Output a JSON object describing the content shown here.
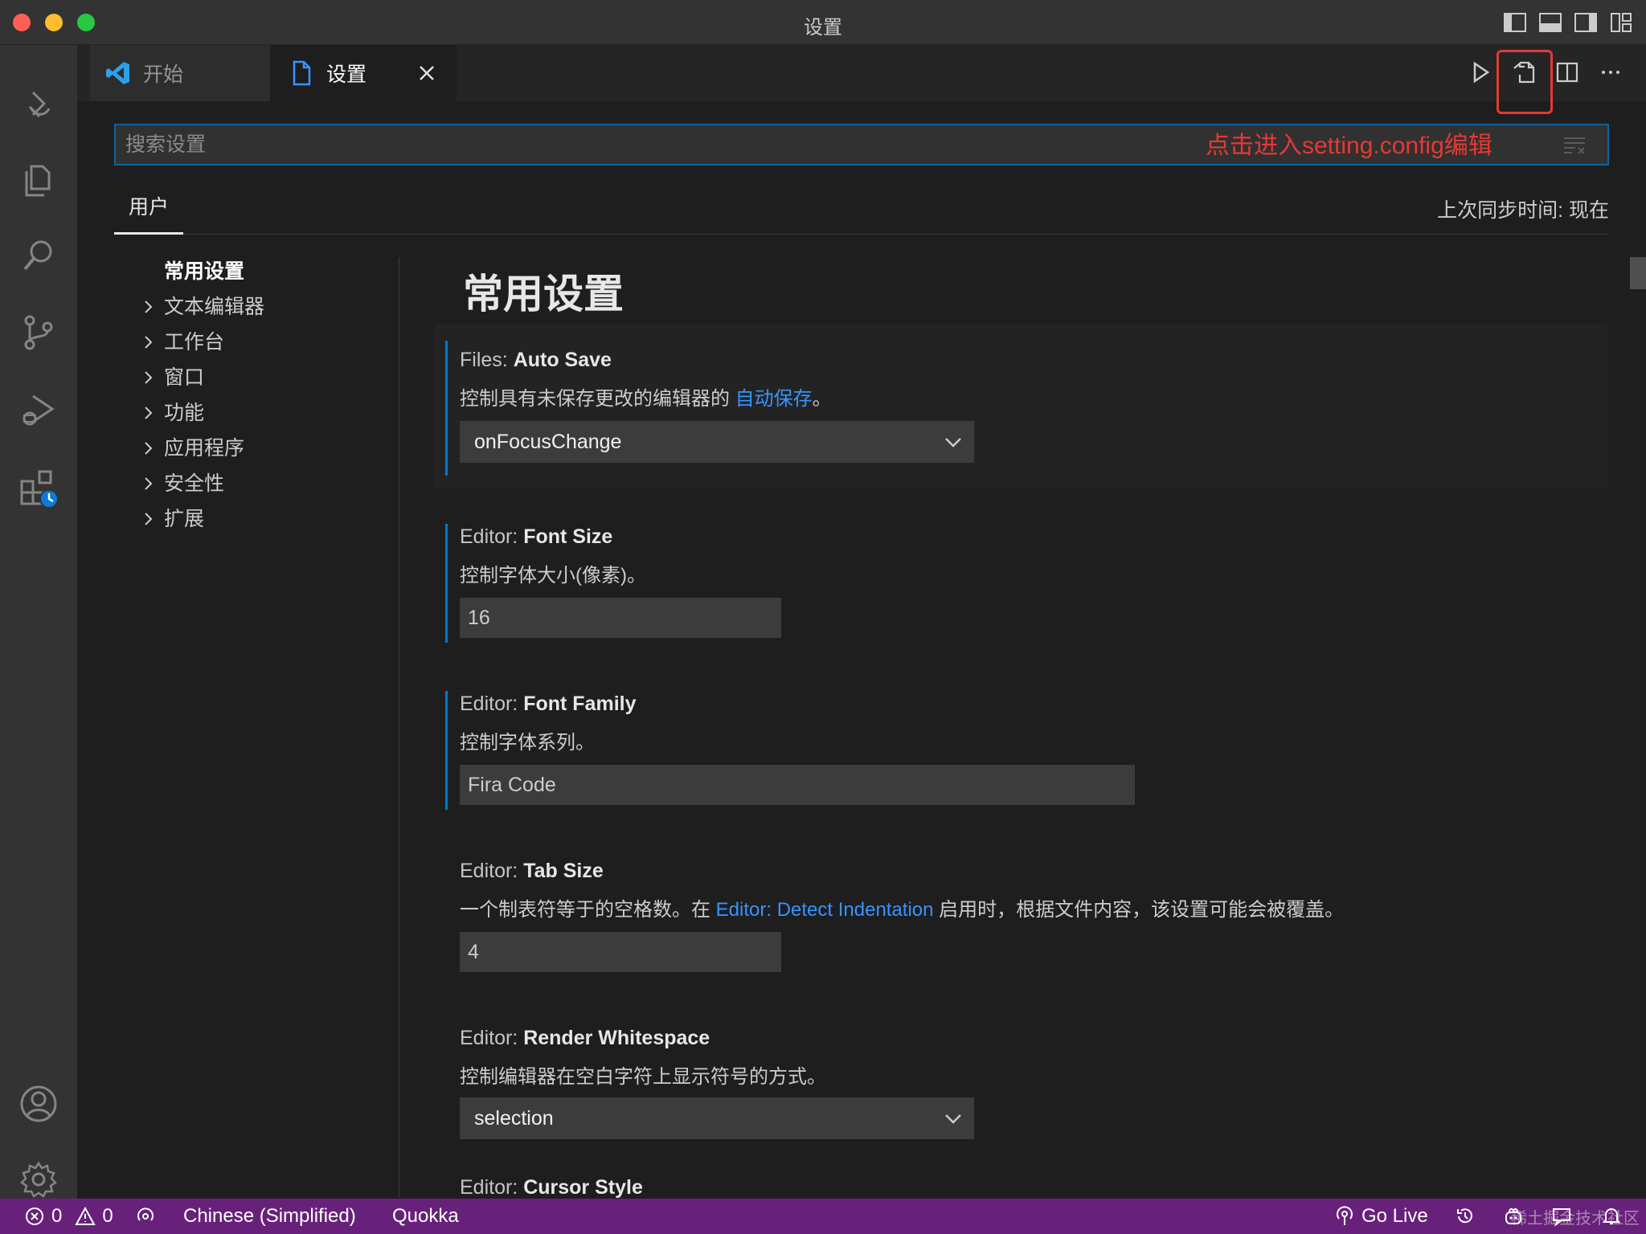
{
  "window": {
    "title": "设置"
  },
  "tabs": [
    {
      "label": "开始"
    },
    {
      "label": "设置"
    }
  ],
  "annotation": {
    "text": "点击进入setting.config编辑",
    "color": "#e53935"
  },
  "search": {
    "placeholder": "搜索设置"
  },
  "scope": {
    "user_tab": "用户",
    "sync_status": "上次同步时间: 现在"
  },
  "toc": {
    "items": [
      {
        "label": "常用设置"
      },
      {
        "label": "文本编辑器"
      },
      {
        "label": "工作台"
      },
      {
        "label": "窗口"
      },
      {
        "label": "功能"
      },
      {
        "label": "应用程序"
      },
      {
        "label": "安全性"
      },
      {
        "label": "扩展"
      }
    ]
  },
  "content": {
    "heading": "常用设置",
    "settings": [
      {
        "category": "Files: ",
        "name": "Auto Save",
        "desc_prefix": "控制具有未保存更改的编辑器的 ",
        "desc_link": "自动保存",
        "desc_suffix": "。",
        "value": "onFocusChange"
      },
      {
        "category": "Editor: ",
        "name": "Font Size",
        "desc": "控制字体大小(像素)。",
        "value": "16"
      },
      {
        "category": "Editor: ",
        "name": "Font Family",
        "desc": "控制字体系列。",
        "value": "Fira Code"
      },
      {
        "category": "Editor: ",
        "name": "Tab Size",
        "desc_prefix": "一个制表符等于的空格数。在 ",
        "desc_link": "Editor: Detect Indentation",
        "desc_suffix": " 启用时，根据文件内容，该设置可能会被覆盖。",
        "value": "4"
      },
      {
        "category": "Editor: ",
        "name": "Render Whitespace",
        "desc": "控制编辑器在空白字符上显示符号的方式。",
        "value": "selection"
      },
      {
        "category": "Editor: ",
        "name": "Cursor Style"
      }
    ]
  },
  "statusbar": {
    "errors": "0",
    "warnings": "0",
    "language": "Chinese (Simplified)",
    "quokka": "Quokka",
    "go_live": "Go Live",
    "color": "#68217a"
  },
  "watermark": "稀土掘金技术社区",
  "accent": "#007acc"
}
